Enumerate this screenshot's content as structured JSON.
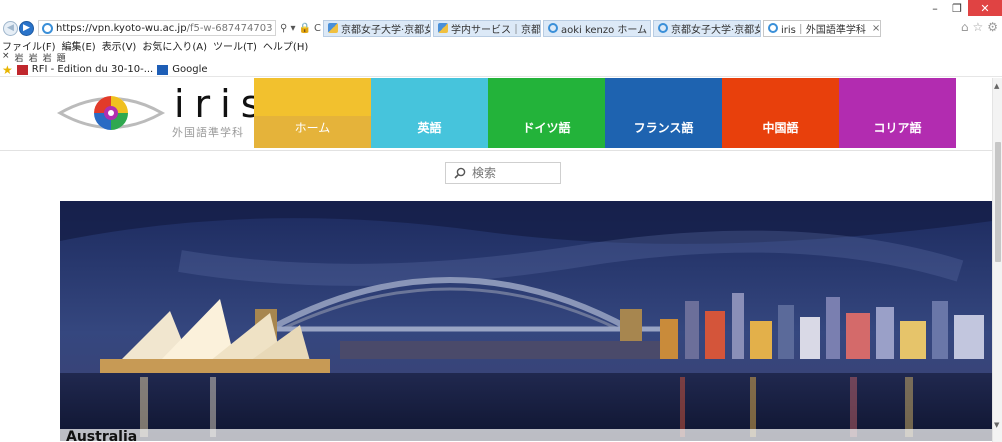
{
  "window": {
    "minimize": "–",
    "maximize": "❐",
    "close": "✕"
  },
  "browser": {
    "address": {
      "host": "https://vpn.kyoto-wu.ac.jp",
      "path": "/f5-w-687474703",
      "tools": [
        "⚲ ▾",
        "🔒",
        "C"
      ]
    },
    "tabs": [
      {
        "label": "京都女子大学·京都女...",
        "icon": "kwu-icon"
      },
      {
        "label": "学内サービス｜京都女...",
        "icon": "kwu-icon"
      },
      {
        "label": "aoki kenzo ホーム",
        "icon": "ie-icon"
      },
      {
        "label": "京都女子大学·京都女...",
        "icon": "ie-icon"
      },
      {
        "label": "iris｜外国語準学科",
        "icon": "ie-icon",
        "active": true
      }
    ],
    "tab_close": "×",
    "right_icons": [
      "⌂",
      "☆",
      "⚙"
    ],
    "menu": [
      "ファイル(F)",
      "編集(E)",
      "表示(V)",
      "お気に入り(A)",
      "ツール(T)",
      "ヘルプ(H)"
    ],
    "command_icons": [
      "×",
      "岩",
      "岩",
      "岩",
      "題"
    ],
    "favorites": [
      {
        "label": "RFI - Edition du 30-10-...",
        "icon": "rfi-icon"
      },
      {
        "label": "Google",
        "icon": "google-icon"
      }
    ]
  },
  "site": {
    "logo": {
      "word": "iris",
      "subtitle": "外国語準学科"
    },
    "nav": [
      {
        "label": "ホーム",
        "color": "#f2c12e",
        "band": "#e5b33a",
        "label_weight": "normal"
      },
      {
        "label": "英語",
        "color": "#46c4dc",
        "band": "#46c4dc"
      },
      {
        "label": "ドイツ語",
        "color": "#23b33a",
        "band": "#23b33a"
      },
      {
        "label": "フランス語",
        "color": "#1e63b0",
        "band": "#1e63b0"
      },
      {
        "label": "中国語",
        "color": "#e8400c",
        "band": "#e8400c"
      },
      {
        "label": "コリア語",
        "color": "#b22cb0",
        "band": "#b22cb0"
      }
    ],
    "search": {
      "placeholder": "検索",
      "icon": "search-icon"
    },
    "banner": {
      "caption": "Australia",
      "subject": "sydney-harbour-night-photo"
    }
  }
}
